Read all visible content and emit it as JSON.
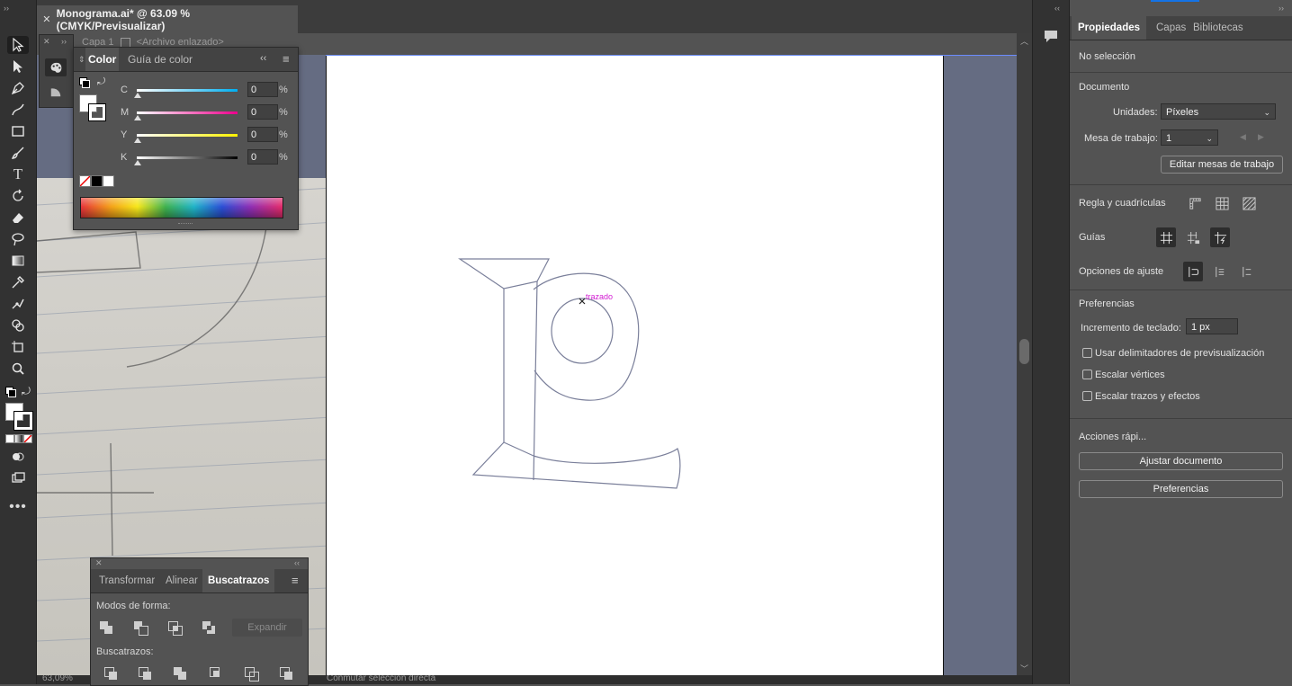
{
  "document": {
    "tab_title": "Monograma.ai* @ 63.09 % (CMYK/Previsualizar)",
    "layer_breadcrumb": "Capa 1",
    "linked_file": "<Archivo enlazado>",
    "zoom": "63,09%",
    "status_tool": "Conmutar selección directa"
  },
  "canvas": {
    "hint_label": "trazado"
  },
  "color_panel": {
    "tab_color": "Color",
    "tab_color_guide": "Guía de color",
    "sliders": [
      {
        "label": "C",
        "value": "0",
        "unit": "%",
        "gradient": [
          "#ffffff",
          "#00aeef"
        ]
      },
      {
        "label": "M",
        "value": "0",
        "unit": "%",
        "gradient": [
          "#ffffff",
          "#ec008c"
        ]
      },
      {
        "label": "Y",
        "value": "0",
        "unit": "%",
        "gradient": [
          "#ffffff",
          "#fff200"
        ]
      },
      {
        "label": "K",
        "value": "0",
        "unit": "%",
        "gradient": [
          "#ffffff",
          "#000000"
        ]
      }
    ]
  },
  "pathfinder_panel": {
    "tab_transform": "Transformar",
    "tab_align": "Alinear",
    "tab_pathfinder": "Buscatrazos",
    "shape_modes_label": "Modos de forma:",
    "expand_label": "Expandir",
    "pathfinders_label": "Buscatrazos:"
  },
  "properties": {
    "tab_properties": "Propiedades",
    "tab_layers": "Capas",
    "tab_libraries": "Bibliotecas",
    "no_selection": "No selección",
    "document_heading": "Documento",
    "units_label": "Unidades:",
    "units_value": "Píxeles",
    "artboard_label": "Mesa de trabajo:",
    "artboard_value": "1",
    "edit_artboards_button": "Editar mesas de trabajo",
    "rulers_grids_label": "Regla y cuadrículas",
    "guides_label": "Guías",
    "snap_options_label": "Opciones de ajuste",
    "preferences_heading": "Preferencias",
    "keyboard_increment_label": "Incremento de teclado:",
    "keyboard_increment_value": "1 px",
    "checkboxes": [
      "Usar delimitadores de previsualización",
      "Escalar vértices",
      "Escalar trazos y efectos"
    ],
    "quick_actions_heading": "Acciones rápi...",
    "fit_document_button": "Ajustar documento",
    "preferences_button": "Preferencias"
  },
  "colors": {
    "accent": "#1473e6",
    "path_stroke": "#7a7f9a",
    "hint": "#d21bd2",
    "artboard_bg": "#656c82"
  }
}
